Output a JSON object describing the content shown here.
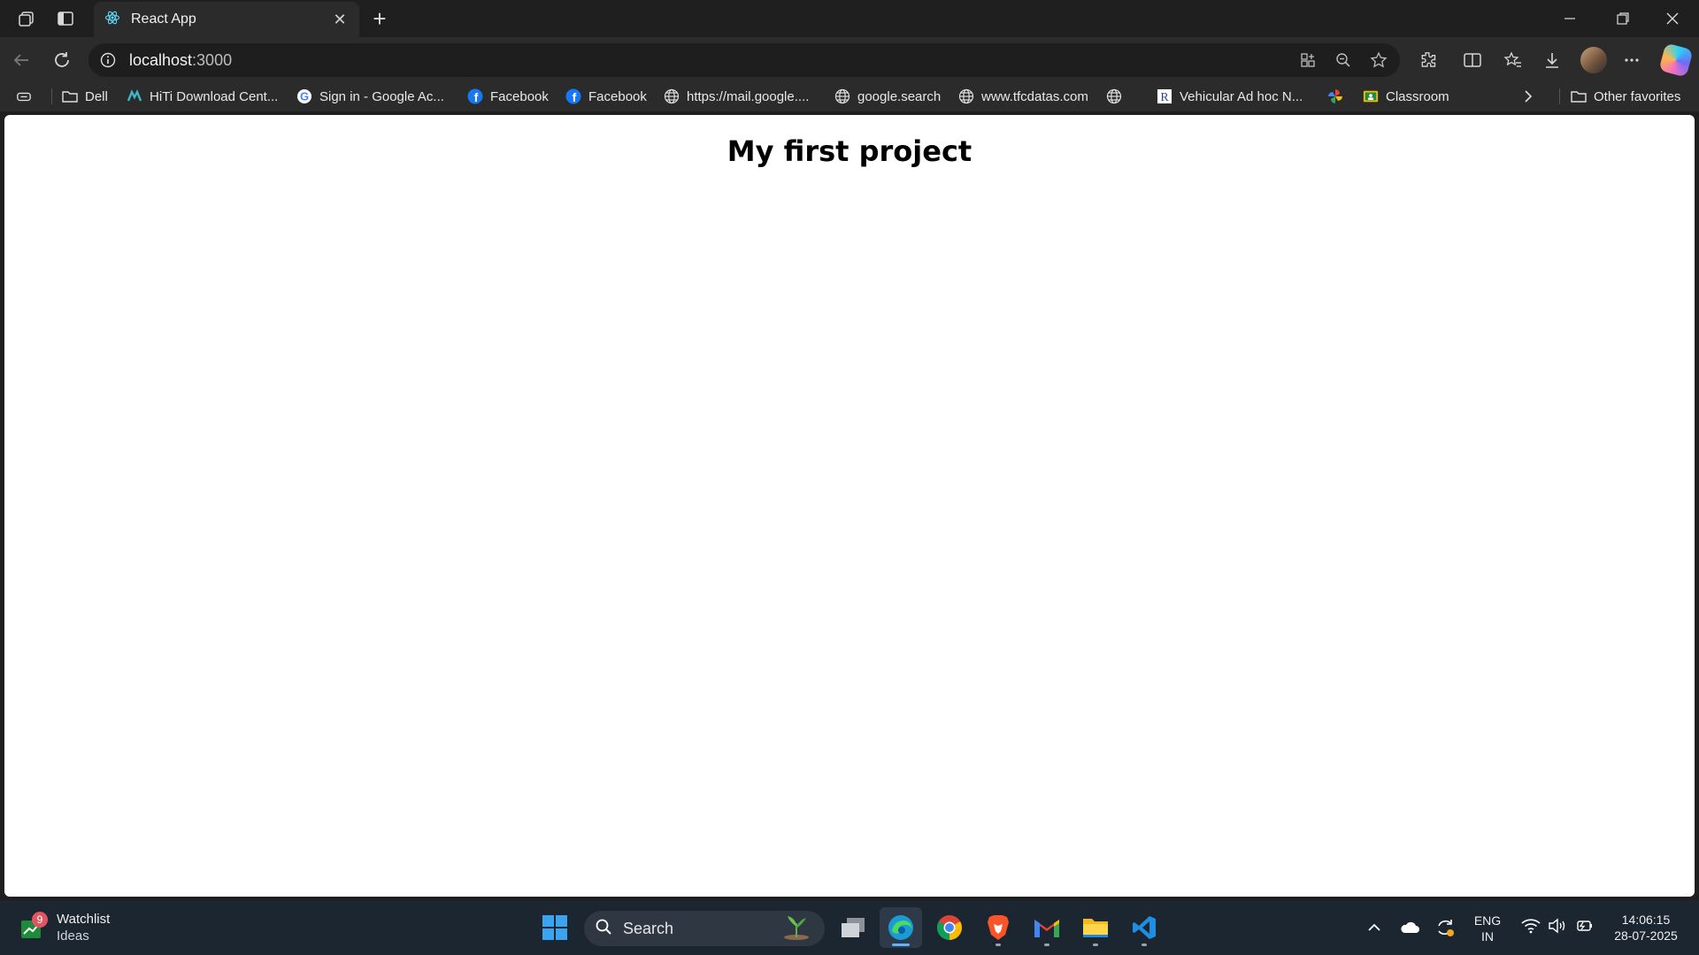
{
  "browser": {
    "tab_title": "React App",
    "address_host": "localhost",
    "address_port": ":3000"
  },
  "bookmarks": [
    {
      "label": "Dell",
      "icon": "folder-icon"
    },
    {
      "label": "HiTi Download Cent...",
      "icon": "hiti-icon"
    },
    {
      "label": "Sign in - Google Ac...",
      "icon": "google-icon"
    },
    {
      "label": "Facebook",
      "icon": "facebook-icon"
    },
    {
      "label": "Facebook",
      "icon": "facebook-icon"
    },
    {
      "label": "https://mail.google....",
      "icon": "globe-icon"
    },
    {
      "label": "google.search",
      "icon": "globe-icon"
    },
    {
      "label": "www.tfcdatas.com",
      "icon": "globe-icon"
    },
    {
      "label": "",
      "icon": "globe-icon"
    },
    {
      "label": "Vehicular Ad hoc N...",
      "icon": "r-site-icon"
    },
    {
      "label": "",
      "icon": "pinwheel-icon"
    },
    {
      "label": "Classroom",
      "icon": "classroom-icon"
    }
  ],
  "other_favorites": "Other favorites",
  "page": {
    "heading": "My first project"
  },
  "taskbar": {
    "widget_badge": "9",
    "widget_title": "Watchlist",
    "widget_sub": "Ideas",
    "search_label": "Search",
    "lang_top": "ENG",
    "lang_bottom": "IN",
    "time": "14:06:15",
    "date": "28-07-2025"
  }
}
